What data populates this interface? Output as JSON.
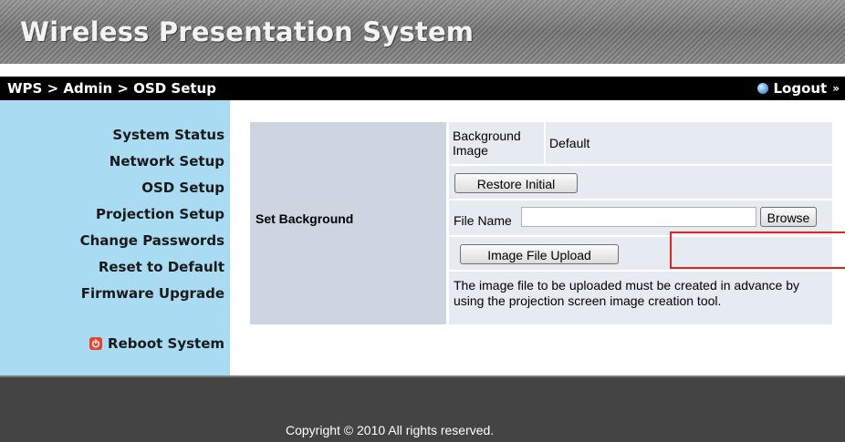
{
  "header": {
    "title": "Wireless Presentation System"
  },
  "nav": {
    "breadcrumb": "WPS > Admin > OSD Setup",
    "logout": "Logout",
    "logout_arrow": "»"
  },
  "sidebar": {
    "items": [
      {
        "label": "System Status"
      },
      {
        "label": "Network Setup"
      },
      {
        "label": "OSD Setup"
      },
      {
        "label": "Projection Setup"
      },
      {
        "label": "Change Passwords"
      },
      {
        "label": "Reset to Default"
      },
      {
        "label": "Firmware Upgrade"
      }
    ],
    "reboot": {
      "label": "Reboot System",
      "icon": "power-icon"
    }
  },
  "main": {
    "section_label": "Set Background",
    "background_image": {
      "label": "Background Image",
      "value": "Default"
    },
    "restore_button": "Restore Initial",
    "file_name": {
      "label": "File Name",
      "value": "",
      "placeholder": ""
    },
    "browse_button": "Browse",
    "upload_button": "Image File Upload",
    "note": "The image file to be uploaded must be created in advance by using the projection screen image creation tool."
  },
  "footer": {
    "copyright": "Copyright © 2010 All rights reserved."
  },
  "colors": {
    "sidebar_bg": "#a9dcf2",
    "navbar_bg": "#000000",
    "footer_bg": "#444444",
    "label_cell_bg": "#cdd6e0",
    "row_bg": "#e6ebf2",
    "highlight": "#e0261c"
  }
}
